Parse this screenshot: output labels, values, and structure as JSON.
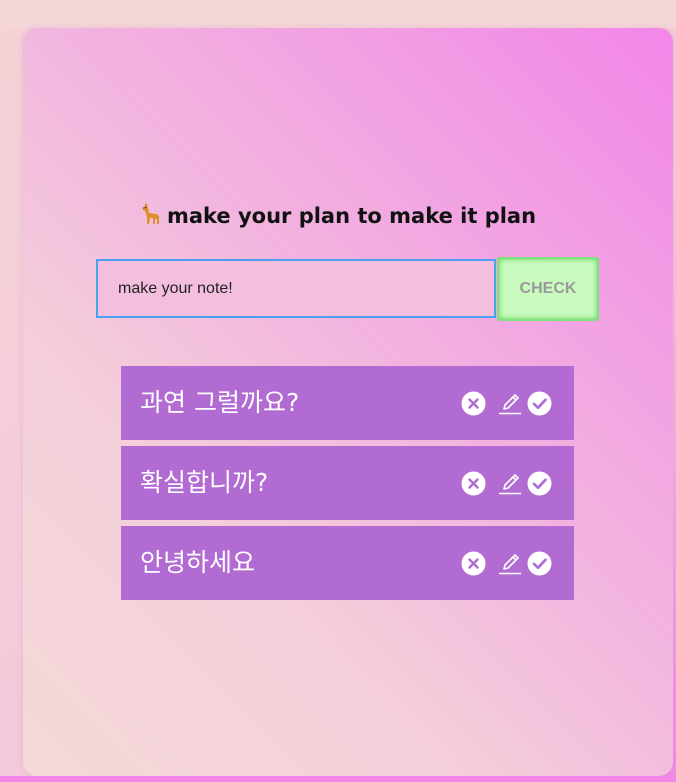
{
  "header": {
    "emoji": "llama-emoji",
    "title": "make your plan to make it plan"
  },
  "input": {
    "placeholder": "make your note!",
    "value": ""
  },
  "check_button": {
    "label": "CHECK"
  },
  "todos": [
    {
      "text": "과연 그럴까요?"
    },
    {
      "text": "확실합니까?"
    },
    {
      "text": "안녕하세요"
    }
  ],
  "icons": {
    "delete": "close-circle-icon",
    "edit": "pencil-icon",
    "done": "check-circle-icon"
  },
  "colors": {
    "todo_background": "#b26bd2",
    "check_button_background": "#c9fbbf",
    "input_border": "#4a9ff0",
    "page_gradient_end": "#ef86e8"
  }
}
